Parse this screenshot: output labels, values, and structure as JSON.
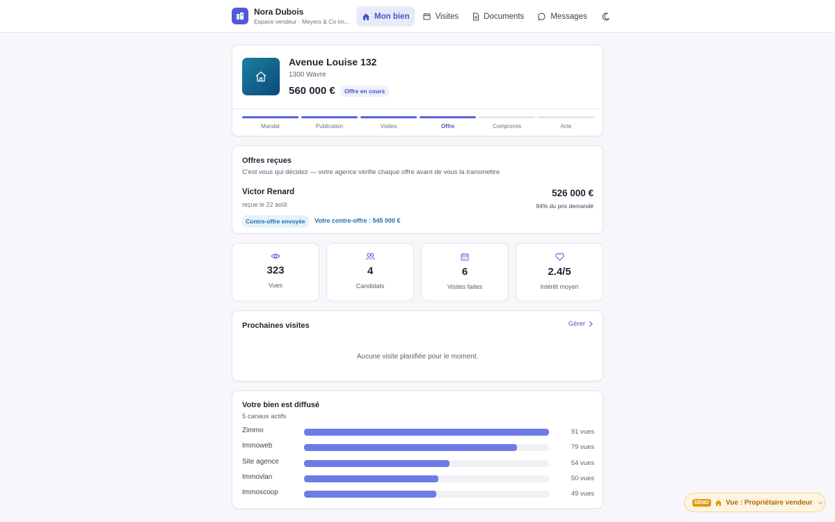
{
  "header": {
    "name": "Nora Dubois",
    "subtitle": "Espace vendeur · Meyers & Co Im...",
    "nav": [
      {
        "label": "Mon bien",
        "icon": "home-icon",
        "active": true
      },
      {
        "label": "Visites",
        "icon": "calendar-icon",
        "active": false
      },
      {
        "label": "Documents",
        "icon": "document-icon",
        "active": false
      },
      {
        "label": "Messages",
        "icon": "message-icon",
        "active": false
      }
    ],
    "theme_icon": "moon-icon"
  },
  "property": {
    "title": "Avenue Louise 132",
    "city": "1300 Wavre",
    "price": "560 000 €",
    "status_badge": "Offre en cours",
    "steps": [
      {
        "label": "Mandat",
        "done": true,
        "current": false
      },
      {
        "label": "Publication",
        "done": true,
        "current": false
      },
      {
        "label": "Visites",
        "done": true,
        "current": false
      },
      {
        "label": "Offre",
        "done": true,
        "current": true
      },
      {
        "label": "Compromis",
        "done": false,
        "current": false
      },
      {
        "label": "Acte",
        "done": false,
        "current": false
      }
    ]
  },
  "offers": {
    "title": "Offres reçues",
    "subtitle": "C'est vous qui décidez — votre agence vérifie chaque offre avant de vous la transmettre",
    "buyer": "Victor Renard",
    "received": "reçue le 22 août",
    "amount": "526 000 €",
    "percent": "94% du prix demandé",
    "chip": "Contre-offre envoyée",
    "counter": "Votre contre-offre : 545 000 €"
  },
  "stats": [
    {
      "icon": "eye-icon",
      "value": "323",
      "label": "Vues"
    },
    {
      "icon": "users-icon",
      "value": "4",
      "label": "Candidats"
    },
    {
      "icon": "calendar-icon",
      "value": "6",
      "label": "Visites faites"
    },
    {
      "icon": "heart-icon",
      "value": "2.4/5",
      "label": "Intérêt moyen"
    }
  ],
  "visits": {
    "title": "Prochaines visites",
    "manage": "Gérer",
    "empty": "Aucune visite planifiée pour le moment."
  },
  "channels": {
    "title": "Votre bien est diffusé",
    "subtitle": "5 canaux actifs",
    "max_views": 91,
    "items": [
      {
        "name": "Zimmo",
        "views": 91,
        "views_label": "91 vues"
      },
      {
        "name": "Immoweb",
        "views": 79,
        "views_label": "79 vues"
      },
      {
        "name": "Site agence",
        "views": 54,
        "views_label": "54 vues"
      },
      {
        "name": "Immovlan",
        "views": 50,
        "views_label": "50 vues"
      },
      {
        "name": "Immoscoop",
        "views": 49,
        "views_label": "49 vues"
      }
    ]
  },
  "demo": {
    "tag": "DÉMO",
    "label": "Vue : Propriétaire vendeur"
  },
  "colors": {
    "accent": "#4f5bd5",
    "bar": "#6c7be5",
    "counter": "#1f6fa7",
    "demo": "#e29a10"
  }
}
